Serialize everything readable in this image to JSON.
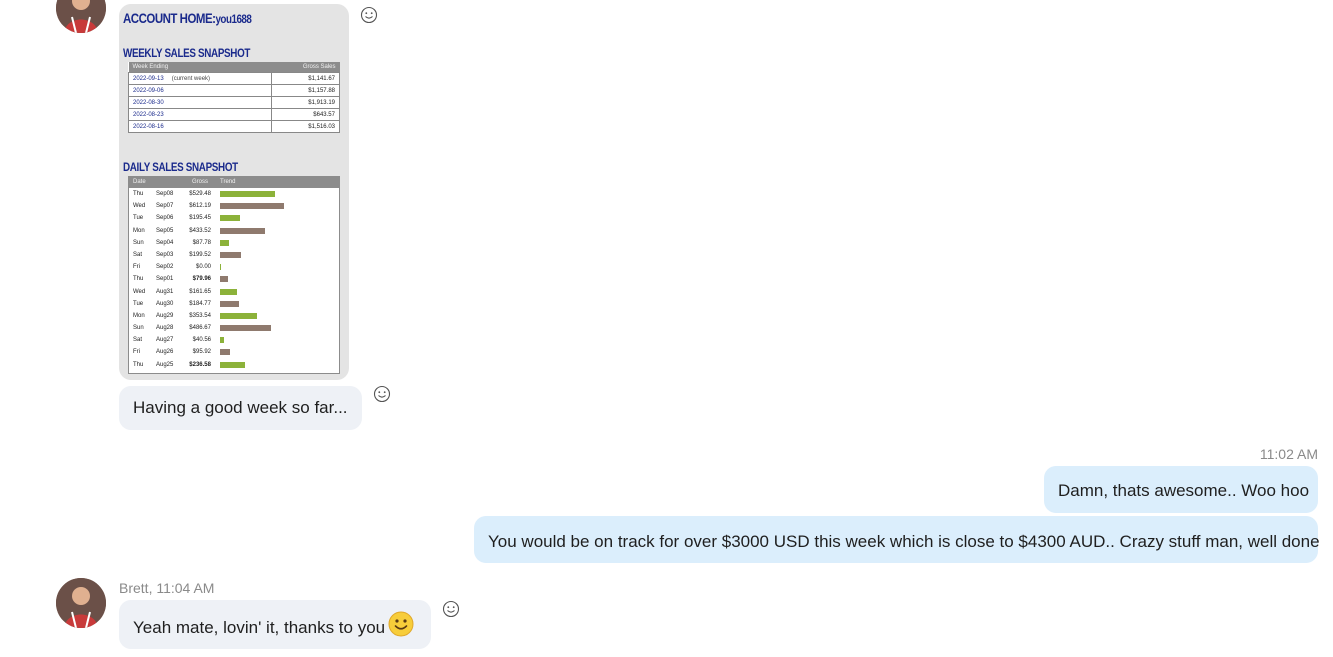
{
  "colors": {
    "incoming_bubble": "#eef1f6",
    "outgoing_bubble": "#dbeefc",
    "bar_green": "#8cb23a",
    "bar_brown": "#8f7a6e",
    "report_blue": "#1a2a8c"
  },
  "icons": [
    "avatar",
    "smiley-reaction-icon",
    "smiley-emoji-icon"
  ],
  "image_message": {
    "account_home_label": "ACCOUNT HOME:",
    "account_user": "you1688",
    "weekly_title": "WEEKLY SALES SNAPSHOT",
    "weekly_headers": [
      "Week Ending",
      "Gross Sales"
    ],
    "weekly_rows": [
      {
        "week": "2022-09-13",
        "note": "(current week)",
        "gross": "$1,141.67"
      },
      {
        "week": "2022-09-06",
        "note": "",
        "gross": "$1,157.88"
      },
      {
        "week": "2022-08-30",
        "note": "",
        "gross": "$1,913.19"
      },
      {
        "week": "2022-08-23",
        "note": "",
        "gross": "$643.57"
      },
      {
        "week": "2022-08-16",
        "note": "",
        "gross": "$1,516.03"
      }
    ],
    "daily_title": "DAILY SALES SNAPSHOT",
    "daily_headers": [
      "Date",
      "Gross",
      "Trend"
    ],
    "daily_rows": [
      {
        "day": "Thu",
        "date": "Sep08",
        "gross": "$529.48",
        "value": 529.48,
        "color": "green",
        "bold": false
      },
      {
        "day": "Wed",
        "date": "Sep07",
        "gross": "$612.19",
        "value": 612.19,
        "color": "brown",
        "bold": false
      },
      {
        "day": "Tue",
        "date": "Sep06",
        "gross": "$195.45",
        "value": 195.45,
        "color": "green",
        "bold": false
      },
      {
        "day": "Mon",
        "date": "Sep05",
        "gross": "$433.52",
        "value": 433.52,
        "color": "brown",
        "bold": false
      },
      {
        "day": "Sun",
        "date": "Sep04",
        "gross": "$87.78",
        "value": 87.78,
        "color": "green",
        "bold": false
      },
      {
        "day": "Sat",
        "date": "Sep03",
        "gross": "$199.52",
        "value": 199.52,
        "color": "brown",
        "bold": false
      },
      {
        "day": "Fri",
        "date": "Sep02",
        "gross": "$0.00",
        "value": 0,
        "color": "green",
        "bold": false
      },
      {
        "day": "Thu",
        "date": "Sep01",
        "gross": "$79.96",
        "value": 79.96,
        "color": "brown",
        "bold": true
      },
      {
        "day": "Wed",
        "date": "Aug31",
        "gross": "$161.65",
        "value": 161.65,
        "color": "green",
        "bold": false
      },
      {
        "day": "Tue",
        "date": "Aug30",
        "gross": "$184.77",
        "value": 184.77,
        "color": "brown",
        "bold": false
      },
      {
        "day": "Mon",
        "date": "Aug29",
        "gross": "$353.54",
        "value": 353.54,
        "color": "green",
        "bold": false
      },
      {
        "day": "Sun",
        "date": "Aug28",
        "gross": "$486.67",
        "value": 486.67,
        "color": "brown",
        "bold": false
      },
      {
        "day": "Sat",
        "date": "Aug27",
        "gross": "$40.56",
        "value": 40.56,
        "color": "green",
        "bold": false
      },
      {
        "day": "Fri",
        "date": "Aug26",
        "gross": "$95.92",
        "value": 95.92,
        "color": "brown",
        "bold": false
      },
      {
        "day": "Thu",
        "date": "Aug25",
        "gross": "$236.58",
        "value": 236.58,
        "color": "green",
        "bold": true
      }
    ]
  },
  "messages": {
    "m1_text": "Having a good week so far...",
    "time_1102": "11:02 AM",
    "out1_text": "Damn, thats awesome.. Woo hoo",
    "out2_text": "You would be on track for over $3000 USD this week which is close to $4300 AUD.. Crazy stuff man, well done",
    "brett_meta": "Brett, 11:04 AM",
    "m2_text": "Yeah mate, lovin' it, thanks to you"
  }
}
